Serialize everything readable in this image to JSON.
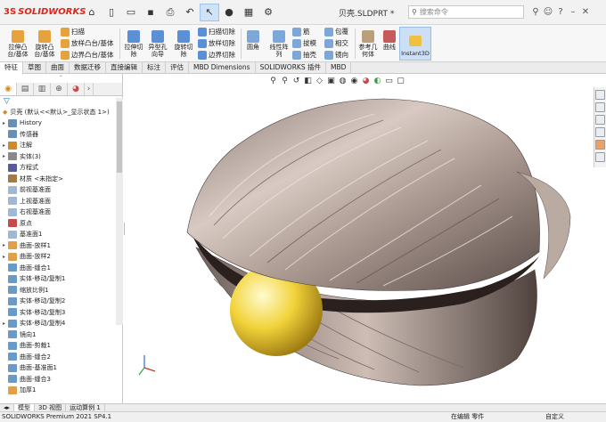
{
  "app": {
    "brand": "SOLIDWORKS",
    "brand_prefix": "3S",
    "document_title": "贝壳.SLDPRT *",
    "search_placeholder": "搜索命令",
    "window_controls": [
      "search-icon",
      "user-icon",
      "help-icon",
      "minimize-icon",
      "close-icon"
    ]
  },
  "quick_access": [
    "home-icon",
    "new-icon",
    "open-icon",
    "save-icon",
    "print-icon",
    "undo-icon",
    "select-icon",
    "traffic-icon",
    "options-icon",
    "gear-icon"
  ],
  "ribbon": {
    "buttons": [
      {
        "label": "拉伸凸\n台/基体",
        "color": "#e6a23c"
      },
      {
        "label": "旋转凸\n台/基体",
        "color": "#e6a23c"
      },
      {
        "label": "拉伸切\n除",
        "color": "#5b8fd6"
      },
      {
        "label": "异型孔\n向导",
        "color": "#5b8fd6"
      },
      {
        "label": "旋转切\n除",
        "color": "#5b8fd6"
      },
      {
        "label": "圆角",
        "color": "#7da7d9"
      },
      {
        "label": "线性阵\n列",
        "color": "#7da7d9"
      },
      {
        "label": "参考几\n何体",
        "color": "#b9a07a"
      },
      {
        "label": "曲线",
        "color": "#c75b5b"
      }
    ],
    "small_buttons": [
      {
        "label": "扫描",
        "color": "#e6a23c"
      },
      {
        "label": "放样凸台/基体",
        "color": "#e6a23c"
      },
      {
        "label": "边界凸台/基体",
        "color": "#e6a23c"
      },
      {
        "label": "扫描切除",
        "color": "#5b8fd6"
      },
      {
        "label": "放样切除",
        "color": "#5b8fd6"
      },
      {
        "label": "边界切除",
        "color": "#5b8fd6"
      },
      {
        "label": "筋",
        "color": "#7da7d9"
      },
      {
        "label": "拔模",
        "color": "#7da7d9"
      },
      {
        "label": "抽壳",
        "color": "#7da7d9"
      },
      {
        "label": "包覆",
        "color": "#7da7d9"
      },
      {
        "label": "相交",
        "color": "#7da7d9"
      },
      {
        "label": "镜向",
        "color": "#7da7d9"
      }
    ],
    "instant3d": "Instant3D"
  },
  "tabs": [
    "特征",
    "草图",
    "曲面",
    "数据迁移",
    "直接编辑",
    "标注",
    "评估",
    "MBD Dimensions",
    "SOLIDWORKS 插件",
    "MBD"
  ],
  "active_tab": 0,
  "feature_tree": {
    "root": "贝壳 (默认<<默认>_显示状态 1>)",
    "items": [
      {
        "label": "History",
        "expand": true,
        "color": "#6a8fb5"
      },
      {
        "label": "传感器",
        "expand": false,
        "color": "#6a8fb5"
      },
      {
        "label": "注解",
        "expand": true,
        "color": "#d08a2e"
      },
      {
        "label": "实体(3)",
        "expand": true,
        "color": "#8a8a8a"
      },
      {
        "label": "方程式",
        "expand": false,
        "color": "#5a5a9a"
      },
      {
        "label": "材质 <未指定>",
        "expand": false,
        "color": "#a07a4a"
      },
      {
        "label": "前视基准面",
        "expand": false,
        "color": "#9fb8d6"
      },
      {
        "label": "上视基准面",
        "expand": false,
        "color": "#9fb8d6"
      },
      {
        "label": "右视基准面",
        "expand": false,
        "color": "#9fb8d6"
      },
      {
        "label": "原点",
        "expand": false,
        "color": "#c84a4a"
      },
      {
        "label": "基准面1",
        "expand": false,
        "color": "#9fb8d6"
      },
      {
        "label": "曲面-放样1",
        "expand": true,
        "color": "#e0a04a"
      },
      {
        "label": "曲面-放样2",
        "expand": true,
        "color": "#e0a04a"
      },
      {
        "label": "曲面-缝合1",
        "expand": false,
        "color": "#6a9ac8"
      },
      {
        "label": "实体-移动/复制1",
        "expand": false,
        "color": "#6a9ac8"
      },
      {
        "label": "缩放比例1",
        "expand": false,
        "color": "#6a9ac8"
      },
      {
        "label": "实体-移动/复制2",
        "expand": false,
        "color": "#6a9ac8"
      },
      {
        "label": "实体-移动/复制3",
        "expand": false,
        "color": "#6a9ac8"
      },
      {
        "label": "实体-移动/复制4",
        "expand": true,
        "color": "#6a9ac8"
      },
      {
        "label": "镜向1",
        "expand": false,
        "color": "#6a9ac8"
      },
      {
        "label": "曲面-剪裁1",
        "expand": false,
        "color": "#6a9ac8"
      },
      {
        "label": "曲面-缝合2",
        "expand": false,
        "color": "#6a9ac8"
      },
      {
        "label": "曲面-基准面1",
        "expand": false,
        "color": "#6a9ac8"
      },
      {
        "label": "曲面-缝合3",
        "expand": false,
        "color": "#6a9ac8"
      },
      {
        "label": "加厚1",
        "expand": false,
        "color": "#e0a04a"
      }
    ]
  },
  "bottom_tabs": [
    "模型",
    "3D 视图",
    "运动算例 1"
  ],
  "status": {
    "left": "SOLIDWORKS Premium 2021 SP4.1",
    "mode": "在编辑 零件",
    "units": "自定义"
  }
}
